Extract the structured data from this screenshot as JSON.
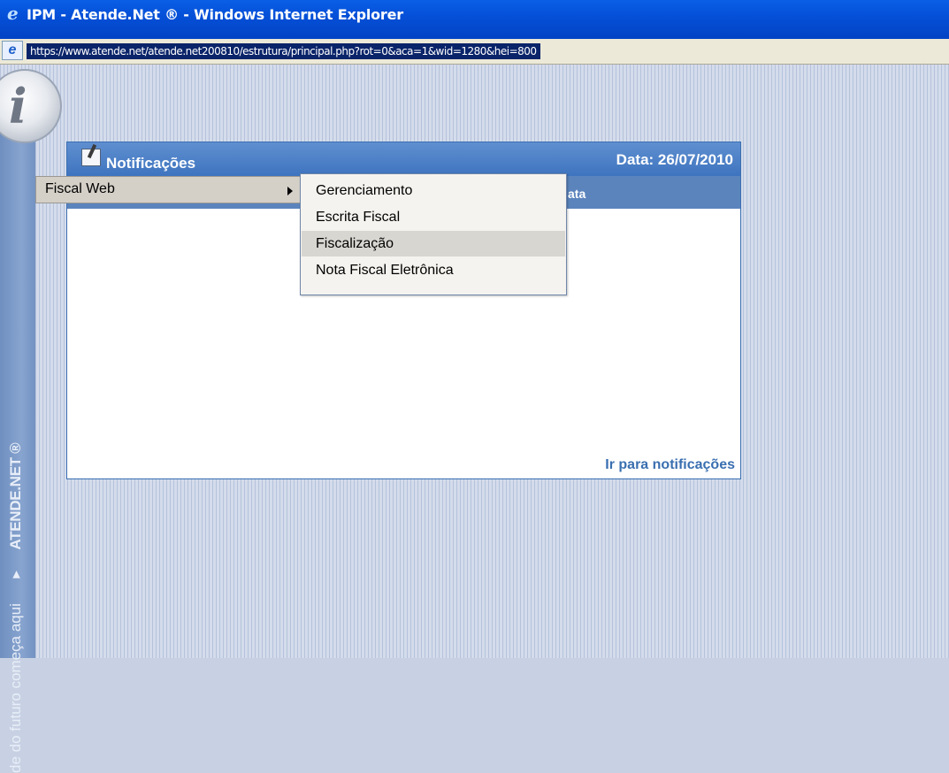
{
  "window": {
    "title": "IPM - Atende.Net ® - Windows Internet Explorer",
    "address": "https://www.atende.net/atende.net200810/estrutura/principal.php?rot=0&aca=1&wid=1280&hei=800"
  },
  "ribbon": {
    "brand": "ATENDE.NET ®",
    "arrow": "▸",
    "tagline": "de do futuro começa aqui"
  },
  "logo": {
    "letter": "i"
  },
  "panel": {
    "title": "Notificações",
    "date": "Data: 26/07/2010",
    "column_label": "ata",
    "link": "Ir para notificações"
  },
  "menu": {
    "parent_label": "Fiscal Web",
    "items": [
      {
        "label": "Gerenciamento"
      },
      {
        "label": "Escrita Fiscal"
      },
      {
        "label": "Fiscalização",
        "highlighted": true
      },
      {
        "label": "Nota Fiscal Eletrônica"
      }
    ]
  },
  "icons": {
    "ie": "ie-logo-icon",
    "page": "page-icon",
    "notes": "notepad-icon",
    "submenu": "chevron-right-icon"
  }
}
